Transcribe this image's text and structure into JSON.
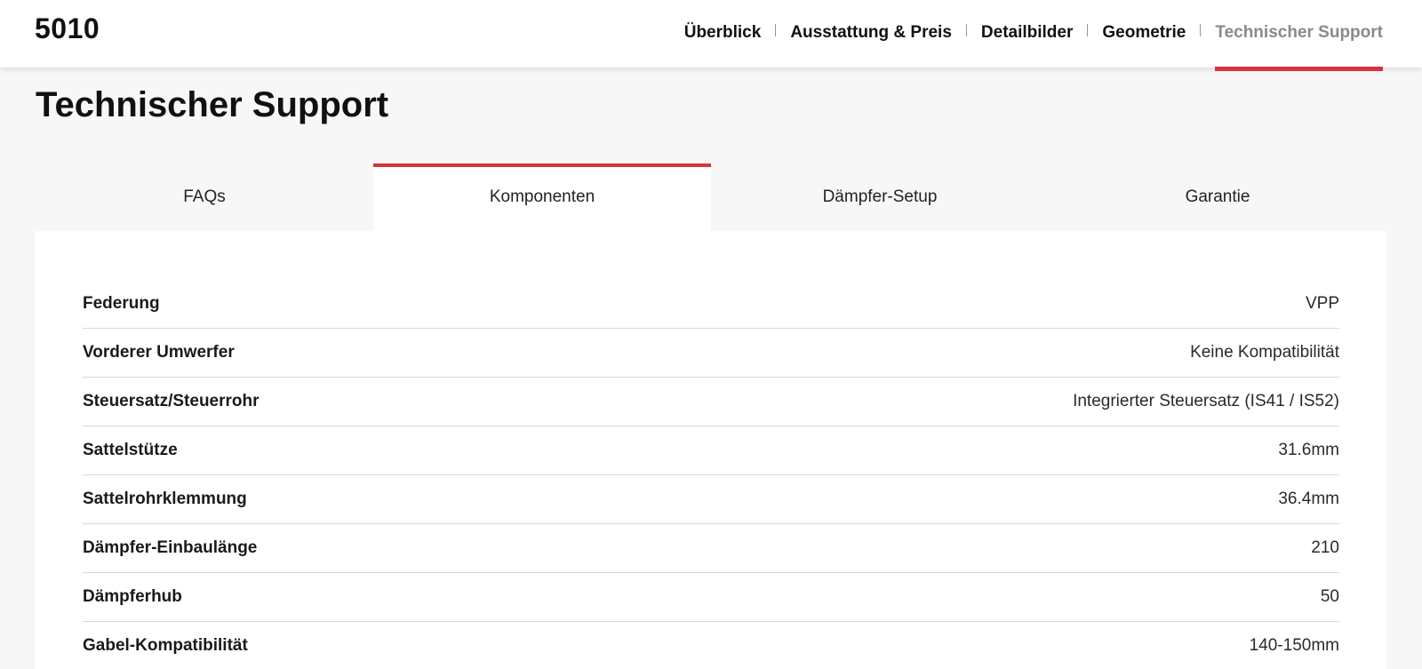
{
  "header": {
    "brand": "5010",
    "nav": [
      {
        "label": "Überblick",
        "active": false
      },
      {
        "label": "Ausstattung & Preis",
        "active": false
      },
      {
        "label": "Detailbilder",
        "active": false
      },
      {
        "label": "Geometrie",
        "active": false
      },
      {
        "label": "Technischer Support",
        "active": true
      }
    ]
  },
  "page": {
    "title": "Technischer Support"
  },
  "tabs": [
    {
      "label": "FAQs",
      "active": false
    },
    {
      "label": "Komponenten",
      "active": true
    },
    {
      "label": "Dämpfer-Setup",
      "active": false
    },
    {
      "label": "Garantie",
      "active": false
    }
  ],
  "specs": [
    {
      "label": "Federung",
      "value": "VPP"
    },
    {
      "label": "Vorderer Umwerfer",
      "value": "Keine Kompatibilität"
    },
    {
      "label": "Steuersatz/Steuerrohr",
      "value": "Integrierter Steuersatz (IS41 / IS52)"
    },
    {
      "label": "Sattelstütze",
      "value": "31.6mm"
    },
    {
      "label": "Sattelrohrklemmung",
      "value": "36.4mm"
    },
    {
      "label": "Dämpfer-Einbaulänge",
      "value": "210"
    },
    {
      "label": "Dämpferhub",
      "value": "50"
    },
    {
      "label": "Gabel-Kompatibilität",
      "value": "140-150mm"
    }
  ],
  "colors": {
    "accent": "#d3353a",
    "background": "#f7f7f7",
    "panel": "#ffffff"
  }
}
